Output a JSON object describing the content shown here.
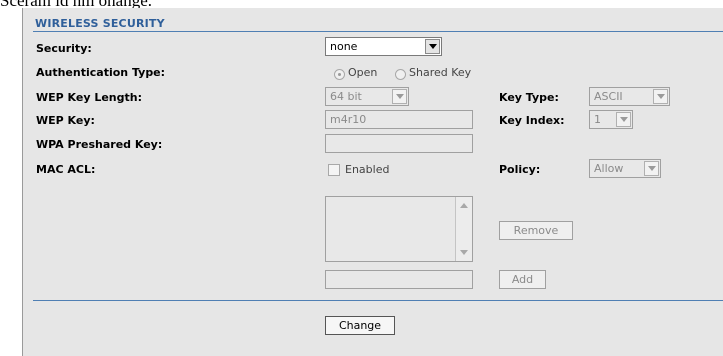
{
  "top_text": "Sceram id nm onange.",
  "section": {
    "title": "WIRELESS SECURITY"
  },
  "security": {
    "label": "Security:",
    "value": "none"
  },
  "auth": {
    "label": "Authentication Type:",
    "option_open": "Open",
    "option_shared": "Shared Key",
    "selected": "Open"
  },
  "wep_key_length": {
    "label": "WEP Key Length:",
    "value": "64 bit"
  },
  "key_type": {
    "label": "Key Type:",
    "value": "ASCII"
  },
  "wep_key": {
    "label": "WEP Key:",
    "value": "m4r10"
  },
  "key_index": {
    "label": "Key Index:",
    "value": "1"
  },
  "wpa": {
    "label": "WPA Preshared Key:",
    "value": ""
  },
  "mac_acl": {
    "label": "MAC ACL:",
    "checkbox_label": "Enabled",
    "checked": false
  },
  "policy": {
    "label": "Policy:",
    "value": "Allow"
  },
  "buttons": {
    "remove": "Remove",
    "add": "Add",
    "change": "Change"
  },
  "mac_input": {
    "value": ""
  }
}
